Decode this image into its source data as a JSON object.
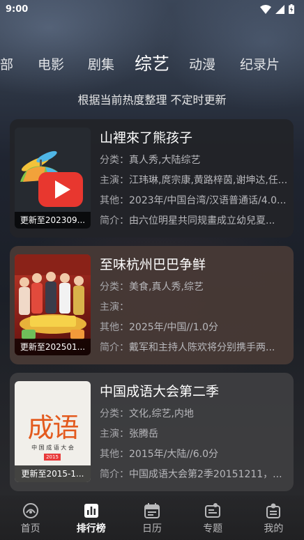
{
  "status_bar": {
    "time": "9:00"
  },
  "tabs": [
    "部",
    "电影",
    "剧集",
    "综艺",
    "动漫",
    "纪录片"
  ],
  "subtitle": "根据当前热度整理 不定时更新",
  "cards": [
    {
      "title": "山裡來了熊孩子",
      "thumb_badge": "更新至202309...",
      "category_label": "分类：",
      "category": "真人秀,大陆综艺",
      "cast_label": "主演：",
      "cast": "江玮琳,庹宗康,黄路梓茵,谢坤达,任...",
      "other_label": "其他：",
      "other": "2023年/中国台湾/汉语普通话/4.0...",
      "summary_label": "简介：",
      "summary": "由六位明星共同规畫成立幼兒夏..."
    },
    {
      "title": "至味杭州巴巴争鲜",
      "thumb_badge": "更新至202501...",
      "category_label": "分类：",
      "category": "美食,真人秀,综艺",
      "cast_label": "主演：",
      "cast": "",
      "other_label": "其他：",
      "other": "2025年/中国//1.0分",
      "summary_label": "简介：",
      "summary": "戴军和主持人陈欢将分别携手两..."
    },
    {
      "title": "中国成语大会第二季",
      "thumb_badge": "更新至2015-1...",
      "category_label": "分类：",
      "category": "文化,综艺,内地",
      "cast_label": "主演：",
      "cast": "张腾岳",
      "other_label": "其他：",
      "other": "2015年/大陆//6.0分",
      "summary_label": "简介：",
      "summary": "中国成语大会第2季20151211，..."
    }
  ],
  "thumb3_text": {
    "big": "成语",
    "caption": "中 国 成 语 大 会",
    "year": "2015"
  },
  "nav": [
    {
      "label": "首页",
      "icon": "home-icon"
    },
    {
      "label": "排行榜",
      "icon": "ranking-icon"
    },
    {
      "label": "日历",
      "icon": "calendar-icon"
    },
    {
      "label": "专题",
      "icon": "topic-icon"
    },
    {
      "label": "我的",
      "icon": "profile-icon"
    }
  ],
  "colors": {
    "accent_red": "#e83a3a",
    "play_red": "#e8372f"
  }
}
